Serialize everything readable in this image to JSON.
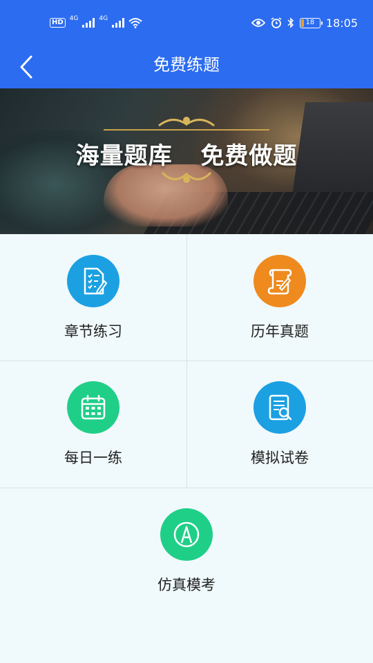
{
  "status_bar": {
    "network_badge": "HD",
    "signal_1": "4G",
    "signal_2": "4G",
    "battery": "18",
    "time": "18:05"
  },
  "nav": {
    "title": "免费练题",
    "back_icon": "chevron-left-icon"
  },
  "banner": {
    "headline": "海量题库 免费做题"
  },
  "grid": {
    "items": [
      {
        "label": "章节练习",
        "icon": "checklist-document-icon",
        "color": "#1ba0e2"
      },
      {
        "label": "历年真题",
        "icon": "scroll-pen-icon",
        "color": "#ee8a1e"
      },
      {
        "label": "每日一练",
        "icon": "calendar-icon",
        "color": "#1fcf88"
      },
      {
        "label": "模拟试卷",
        "icon": "document-search-icon",
        "color": "#1ba0e2"
      },
      {
        "label": "仿真模考",
        "icon": "exam-a-icon",
        "color": "#1fcf88"
      }
    ]
  },
  "colors": {
    "primary": "#2c6cf0",
    "background": "#f0f9fb"
  }
}
